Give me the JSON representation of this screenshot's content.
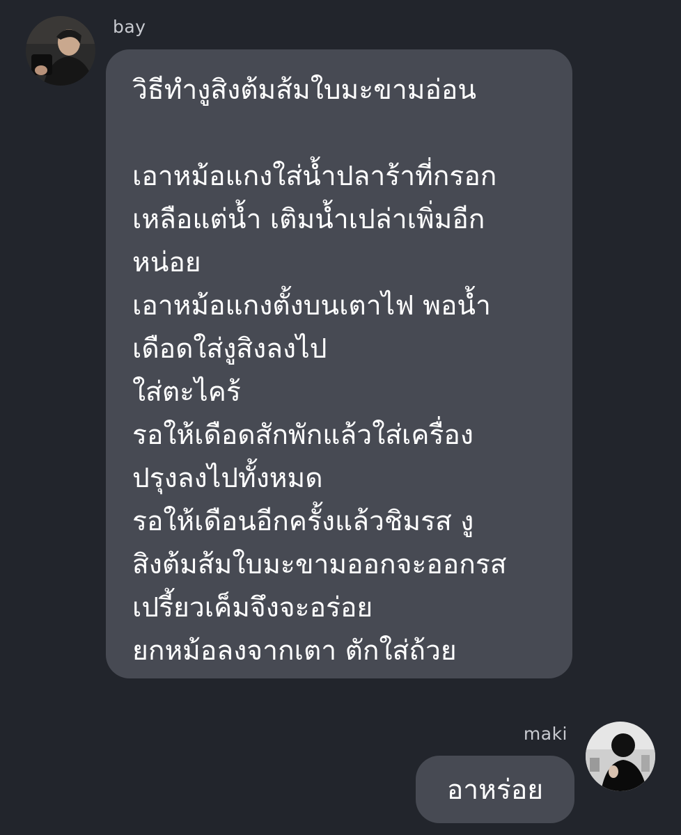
{
  "messages": [
    {
      "sender": "bay",
      "avatar_icon": "user-avatar-photo-icon",
      "lines": [
        "วิธีทำงูสิงต้มส้มใบมะขามอ่อน",
        "",
        "เอาหม้อแกงใส่น้ำปลาร้าที่กรอก",
        "เหลือแต่น้ำ เติมน้ำเปล่าเพิ่มอีก",
        "หน่อย",
        "เอาหม้อแกงตั้งบนเตาไฟ พอน้ำ",
        "เดือดใส่งูสิงลงไป",
        "ใส่ตะไคร้",
        "รอให้เดือดสักพักแล้วใส่เครื่อง",
        "ปรุงลงไปทั้งหมด",
        "รอให้เดือนอีกครั้งแล้วชิมรส  งู",
        "สิงต้มส้มใบมะขามออกจะออกรส",
        "เปรี้ยวเค็มจึงจะอร่อย",
        "ยกหม้อลงจากเตา ตักใส่ถ้วย"
      ]
    },
    {
      "sender": "maki",
      "avatar_icon": "user-avatar-photo-icon",
      "text": "อาหร่อย"
    }
  ],
  "colors": {
    "background": "#22252c",
    "bubble": "#474a53",
    "name_text": "#c8cad0",
    "message_text": "#ffffff"
  }
}
